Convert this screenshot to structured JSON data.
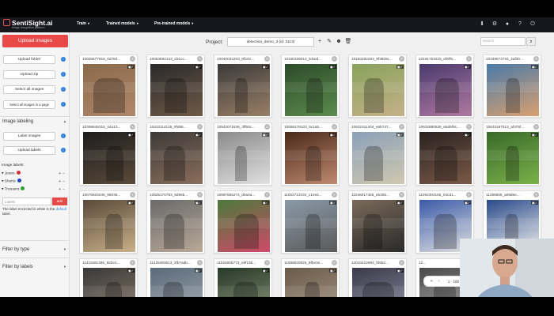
{
  "app": {
    "name": "SentiSight.ai",
    "subtitle": "Image recognition platform",
    "nav": [
      "Train",
      "Trained models",
      "Pre-trained models"
    ]
  },
  "sidebar": {
    "upload_images": "Upload images",
    "upload_folder": "Upload folder",
    "upload_zip": "Upload zip",
    "select_all": "Select all images",
    "select_page": "Select all images in a page",
    "image_labeling": "Image labeling",
    "label_images": "Label images",
    "upload_labels": "Upload labels",
    "image_labels_title": "Image labels:",
    "labels": [
      {
        "name": "Jeans",
        "color": "#d83030"
      },
      {
        "name": "Shorts",
        "color": "#1f3fbf"
      },
      {
        "name": "Trousers",
        "color": "#2e9e2e"
      }
    ],
    "labels_placeholder": "Labels",
    "add_label": "add",
    "note_prefix": "The label encircled in white is the",
    "note_link": "default",
    "note_suffix": "label.",
    "filter_type": "Filter by type",
    "filter_labels": "Filter by labels"
  },
  "project": {
    "label": "Project:",
    "selected": "detection_demo_3 (id: 4113)",
    "search_placeholder": "search"
  },
  "images": [
    {
      "name": "10025677916_0d784..."
    },
    {
      "name": "10054692143_d31cc..."
    },
    {
      "name": "10040034203_8f242..."
    },
    {
      "name": "10160336014_53aaf..."
    },
    {
      "name": "10183292253_9f3829c..."
    },
    {
      "name": "10191753215_eb0f5..."
    },
    {
      "name": "10349674734_2af30..."
    },
    {
      "name": "10358645315_44a13..."
    },
    {
      "name": "10422114125_9fd66..."
    },
    {
      "name": "10542071636_3ff50c..."
    },
    {
      "name": "10558178103_5c1ab..."
    },
    {
      "name": "10632311404_e5b747..."
    },
    {
      "name": "10632880536_66d5f9c..."
    },
    {
      "name": "10633197513_af375f..."
    },
    {
      "name": "10676604036_98035..."
    },
    {
      "name": "10825170793_9d96b..."
    },
    {
      "name": "10897555274_d0a4a..."
    },
    {
      "name": "11002713333_c1e54..."
    },
    {
      "name": "11046017365_eb305..."
    },
    {
      "name": "11092304156_04cd1..."
    },
    {
      "name": "11286655_a09d6e..."
    },
    {
      "name": "11411591386_922e1..."
    },
    {
      "name": "11425493613_2fb7adb..."
    },
    {
      "name": "11526006773_e9f13b..."
    },
    {
      "name": "11598020925_9fbe3e..."
    },
    {
      "name": "12010412894_f0652..."
    },
    {
      "name": "12..."
    },
    {
      "name": ""
    }
  ],
  "pagination": {
    "text": "1 - 100 out of 600 images",
    "page": "1"
  }
}
